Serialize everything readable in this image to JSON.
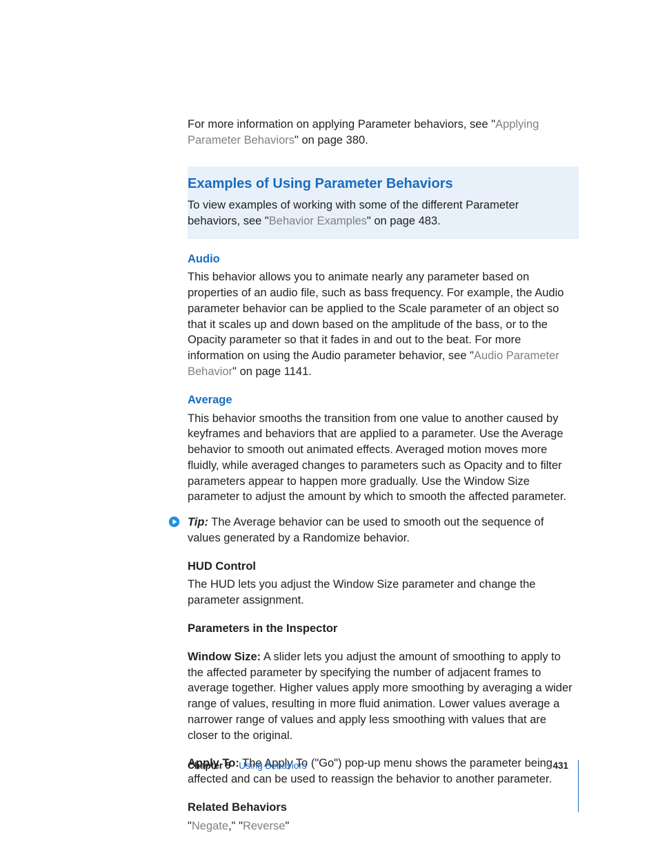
{
  "intro": {
    "text_a": "For more information on applying Parameter behaviors, see \"",
    "link": "Applying Parameter Behaviors",
    "text_b": "\" on page 380."
  },
  "callout": {
    "heading": "Examples of Using Parameter Behaviors",
    "text_a": "To view examples of working with some of the different Parameter behaviors, see \"",
    "link": "Behavior Examples",
    "text_b": "\" on page 483."
  },
  "audio": {
    "heading": "Audio",
    "text_a": "This behavior allows you to animate nearly any parameter based on properties of an audio file, such as bass frequency. For example, the Audio parameter behavior can be applied to the Scale parameter of an object so that it scales up and down based on the amplitude of the bass, or to the Opacity parameter so that it fades in and out to the beat. For more information on using the Audio parameter behavior, see \"",
    "link": "Audio Parameter Behavior",
    "text_b": "\" on page 1141."
  },
  "average": {
    "heading": "Average",
    "body": "This behavior smooths the transition from one value to another caused by keyframes and behaviors that are applied to a parameter. Use the Average behavior to smooth out animated effects. Averaged motion moves more fluidly, while averaged changes to parameters such as Opacity and to filter parameters appear to happen more gradually. Use the Window Size parameter to adjust the amount by which to smooth the affected parameter."
  },
  "tip": {
    "label": "Tip:",
    "body": "  The Average behavior can be used to smooth out the sequence of values generated by a Randomize behavior."
  },
  "hud": {
    "heading": "HUD Control",
    "body": "The HUD lets you adjust the Window Size parameter and change the parameter assignment."
  },
  "inspector_heading": "Parameters in the Inspector",
  "window_size": {
    "label": "Window Size:",
    "body": "  A slider lets you adjust the amount of smoothing to apply to the affected parameter by specifying the number of adjacent frames to average together. Higher values apply more smoothing by averaging a wider range of values, resulting in more fluid animation. Lower values average a narrower range of values and apply less smoothing with values that are closer to the original."
  },
  "apply_to": {
    "label": "Apply To:",
    "body": "  The Apply To (\"Go\") pop-up menu shows the parameter being affected and can be used to reassign the behavior to another parameter."
  },
  "related": {
    "heading": "Related Behaviors",
    "q1": "\"",
    "link1": "Negate",
    "sep": ",\" \"",
    "link2": "Reverse",
    "q2": "\""
  },
  "footer": {
    "chapter_label": "Chapter 5",
    "chapter_name": "Using Behaviors",
    "page": "431"
  }
}
